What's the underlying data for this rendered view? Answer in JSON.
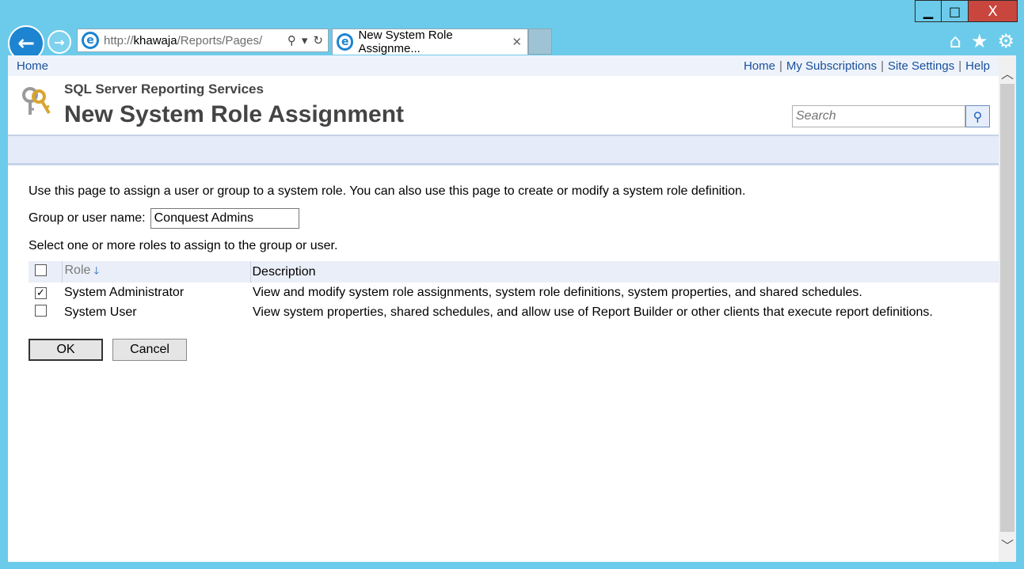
{
  "window": {
    "controls": {
      "minimize_icon": "minimize-icon",
      "maximize_icon": "maximize-icon",
      "close_icon": "close-icon",
      "minimize": "▁",
      "maximize": "□",
      "close": "X"
    }
  },
  "browser": {
    "address": {
      "prefix": "http://",
      "host": "khawaja",
      "path": "/Reports/Pages/"
    },
    "tab_title": "New System Role Assignme...",
    "icons": [
      "back-arrow-icon",
      "forward-arrow-icon",
      "ie-logo-icon",
      "search-icon",
      "dropdown-icon",
      "refresh-icon",
      "tab-close-icon",
      "home-icon",
      "favorites-star-icon",
      "settings-gear-icon"
    ]
  },
  "topnav": {
    "left_home": "Home",
    "links": [
      "Home",
      "My Subscriptions",
      "Site Settings",
      "Help"
    ],
    "separator": "|"
  },
  "header": {
    "product": "SQL Server Reporting Services",
    "title": "New System Role Assignment",
    "search_placeholder": "Search"
  },
  "main": {
    "intro": "Use this page to assign a user or group to a system role. You can also use this page to create or modify a system role definition.",
    "name_label": "Group or user name:",
    "name_value": "Conquest Admins",
    "select_text": "Select one or more roles to assign to the group or user.",
    "table": {
      "headers": {
        "role": "Role",
        "description": "Description"
      },
      "rows": [
        {
          "checked": true,
          "role": "System Administrator",
          "description": "View and modify system role assignments, system role definitions, system properties, and shared schedules."
        },
        {
          "checked": false,
          "role": "System User",
          "description": "View system properties, shared schedules, and allow use of Report Builder or other clients that execute report definitions."
        }
      ]
    },
    "ok_label": "OK",
    "cancel_label": "Cancel"
  }
}
